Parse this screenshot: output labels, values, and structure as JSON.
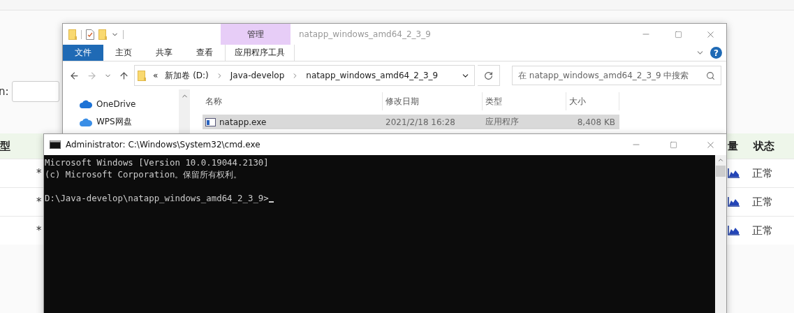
{
  "background_page": {
    "filter_label": "n:",
    "table": {
      "columns": [
        "型",
        "量",
        "状态"
      ],
      "rows": [
        {
          "column_2": "*",
          "status": "正常"
        },
        {
          "column_2": "*",
          "status": "正常"
        },
        {
          "column_2": "*",
          "status": "正常"
        }
      ]
    }
  },
  "explorer": {
    "title": "natapp_windows_amd64_2_3_9",
    "context_group": "管理",
    "help_label": "?",
    "tabs": [
      {
        "label": "文件",
        "selected": true
      },
      {
        "label": "主页",
        "selected": false
      },
      {
        "label": "共享",
        "selected": false
      },
      {
        "label": "查看",
        "selected": false
      },
      {
        "label": "应用程序工具",
        "selected": false
      }
    ],
    "breadcrumb": [
      "«",
      "新加卷 (D:)",
      "Java-develop",
      "natapp_windows_amd64_2_3_9"
    ],
    "search": {
      "placeholder": "在 natapp_windows_amd64_2_3_9 中搜索"
    },
    "nav_items": [
      "OneDrive",
      "WPS网盘"
    ],
    "columns": [
      "名称",
      "修改日期",
      "类型",
      "大小"
    ],
    "files": [
      {
        "name": "natapp.exe",
        "modified": "2021/2/18 16:28",
        "type": "应用程序",
        "size": "8,408 KB",
        "selected": true
      }
    ]
  },
  "console": {
    "title": "Administrator: C:\\Windows\\System32\\cmd.exe",
    "lines": [
      "Microsoft Windows [Version 10.0.19044.2130]",
      "(c) Microsoft Corporation。保留所有权利。"
    ],
    "prompt": "D:\\Java-develop\\natapp_windows_amd64_2_3_9>"
  }
}
